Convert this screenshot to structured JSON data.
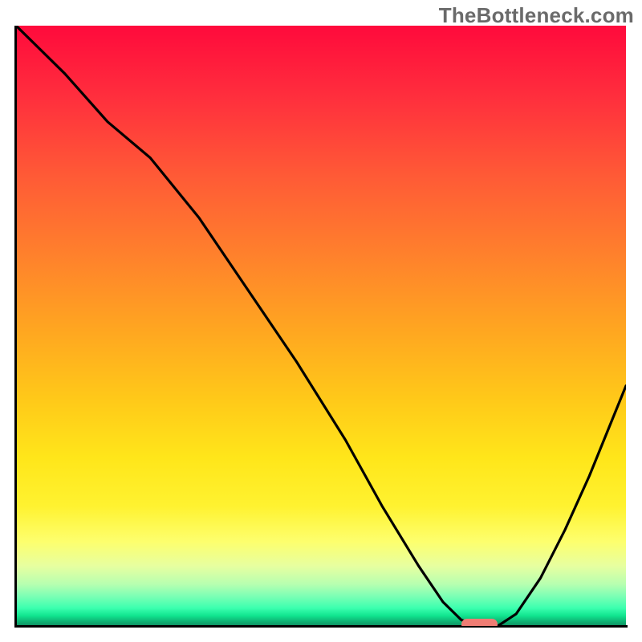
{
  "watermark": "TheBottleneck.com",
  "chart_data": {
    "type": "line",
    "title": "",
    "xlabel": "",
    "ylabel": "",
    "xlim": [
      0,
      100
    ],
    "ylim": [
      0,
      100
    ],
    "x": [
      0,
      8,
      15,
      22,
      30,
      38,
      46,
      54,
      60,
      66,
      70,
      73,
      76,
      79,
      82,
      86,
      90,
      94,
      98,
      100
    ],
    "values": [
      100,
      92,
      84,
      78,
      68,
      56,
      44,
      31,
      20,
      10,
      4,
      1,
      0,
      0,
      2,
      8,
      16,
      25,
      35,
      40
    ],
    "notes": "V-shaped bottleneck curve on rainbow gradient; optimum band marked near x≈75–79.",
    "optimum_marker": {
      "x_start": 73,
      "x_end": 79,
      "y": 0
    },
    "colors": {
      "curve": "#000000",
      "marker": "#ef7d74",
      "gradient_top": "#ff0a3c",
      "gradient_bottom": "#0f8f61"
    }
  }
}
